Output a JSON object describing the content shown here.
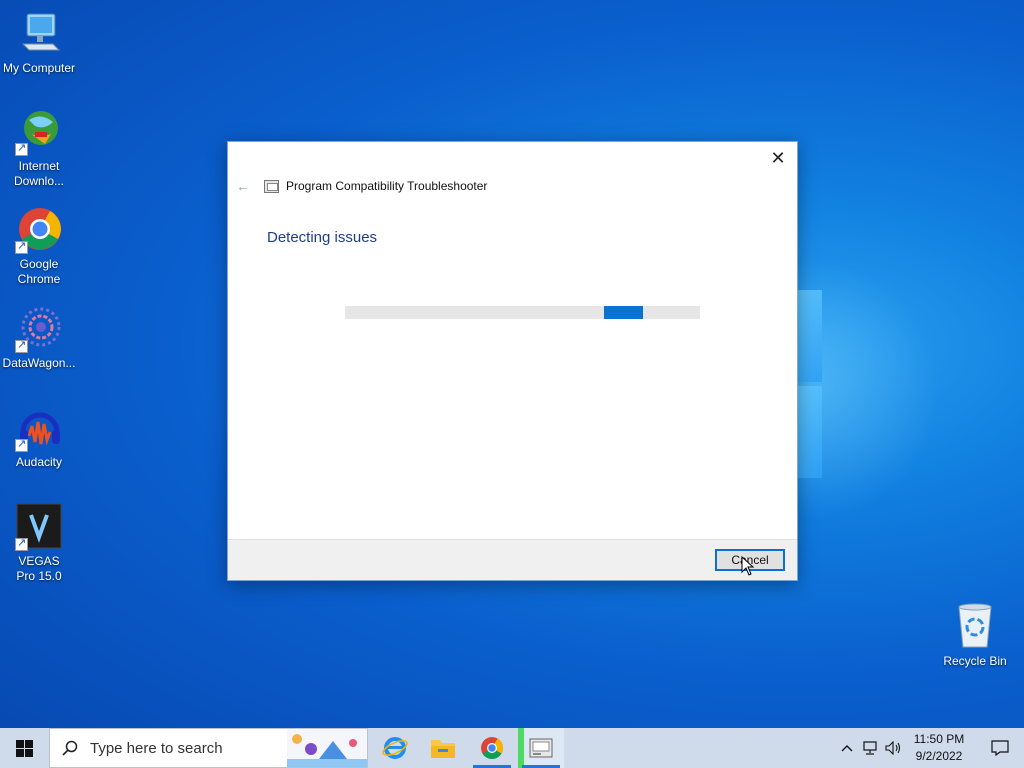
{
  "desktop": {
    "icons": [
      {
        "label": "My Computer"
      },
      {
        "label": "Internet Downlo..."
      },
      {
        "label": "Google Chrome"
      },
      {
        "label": "DataWagon..."
      },
      {
        "label": "Audacity"
      },
      {
        "label": "VEGAS Pro 15.0"
      },
      {
        "label": "Recycle Bin"
      }
    ]
  },
  "dialog": {
    "title": "Program Compatibility Troubleshooter",
    "heading": "Detecting issues",
    "progress_indeterminate": true,
    "cancel_label": "Cancel",
    "close_glyph": "✕",
    "back_glyph": "←"
  },
  "taskbar": {
    "search_placeholder": "Type here to search",
    "apps": [
      {
        "name": "internet-explorer-icon"
      },
      {
        "name": "file-explorer-icon"
      },
      {
        "name": "chrome-icon"
      },
      {
        "name": "troubleshooter-icon"
      }
    ],
    "tray": {
      "chevron": "^",
      "time": "11:50 PM",
      "date": "9/2/2022"
    }
  },
  "colors": {
    "accent": "#0b72d4",
    "heading": "#1e3d8f",
    "taskbar": "#cfdbea"
  }
}
